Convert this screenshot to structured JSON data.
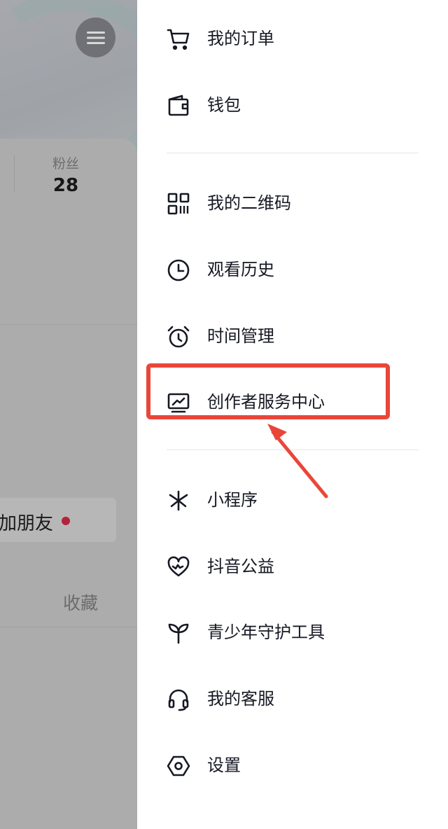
{
  "background_page": {
    "fans_label": "粉丝",
    "fans_count": "28",
    "add_friends": "加朋友",
    "favorites_tab": "收藏"
  },
  "drawer": {
    "items": [
      {
        "label": "我的订单",
        "icon": "cart-icon"
      },
      {
        "label": "钱包",
        "icon": "wallet-icon"
      },
      {
        "label": "我的二维码",
        "icon": "qrcode-icon"
      },
      {
        "label": "观看历史",
        "icon": "clock-icon"
      },
      {
        "label": "时间管理",
        "icon": "alarm-clock-icon"
      },
      {
        "label": "创作者服务中心",
        "icon": "creator-chart-icon"
      },
      {
        "label": "小程序",
        "icon": "mini-program-icon"
      },
      {
        "label": "抖音公益",
        "icon": "heart-charity-icon"
      },
      {
        "label": "青少年守护工具",
        "icon": "sprout-icon"
      },
      {
        "label": "我的客服",
        "icon": "headset-icon"
      },
      {
        "label": "设置",
        "icon": "settings-hexagon-icon"
      }
    ]
  },
  "annotation": {
    "highlighted_item": "创作者服务中心",
    "color": "#e9463a"
  },
  "colors": {
    "text_primary": "#161823",
    "overlay_gray": "#ababab",
    "notification_dot": "#b3243a"
  }
}
